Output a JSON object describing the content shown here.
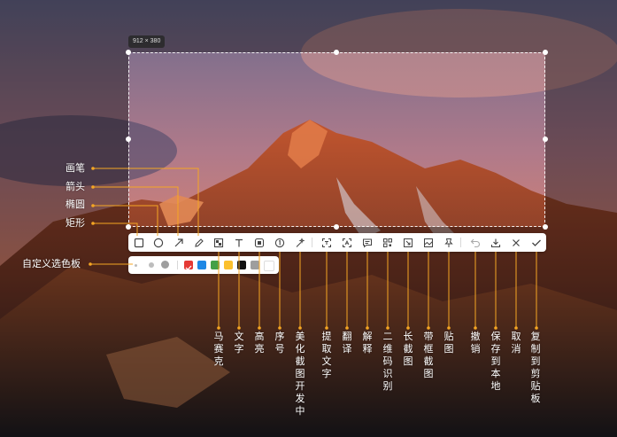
{
  "selection": {
    "size_label": "912 × 380"
  },
  "toolbar": {
    "tools": [
      {
        "id": "rect",
        "icon": "square-icon"
      },
      {
        "id": "ellipse",
        "icon": "circle-icon"
      },
      {
        "id": "arrow",
        "icon": "arrow-icon"
      },
      {
        "id": "pen",
        "icon": "pencil-icon"
      },
      {
        "id": "mosaic",
        "icon": "mosaic-icon"
      },
      {
        "id": "text",
        "icon": "text-icon"
      },
      {
        "id": "highlight",
        "icon": "highlight-icon"
      },
      {
        "id": "number",
        "icon": "number-icon"
      },
      {
        "id": "beautify",
        "icon": "magic-wand-icon"
      },
      {
        "id": "ocr",
        "icon": "ocr-icon"
      },
      {
        "id": "translate",
        "icon": "translate-icon"
      },
      {
        "id": "explain",
        "icon": "explain-icon"
      },
      {
        "id": "qrcode",
        "icon": "qrcode-icon"
      },
      {
        "id": "long-screenshot",
        "icon": "long-screenshot-icon"
      },
      {
        "id": "frame-screenshot",
        "icon": "frame-icon"
      },
      {
        "id": "pin",
        "icon": "pin-icon"
      },
      {
        "id": "undo",
        "icon": "undo-icon"
      },
      {
        "id": "save",
        "icon": "download-icon"
      },
      {
        "id": "cancel",
        "icon": "close-icon"
      },
      {
        "id": "copy",
        "icon": "check-icon"
      }
    ]
  },
  "palette": {
    "colors": [
      "#e53935",
      "#1e88e5",
      "#43a047",
      "#fbc02d",
      "#111111",
      "#9e9e9e",
      "#ffffff"
    ],
    "selected_index": 0
  },
  "left_labels": {
    "pen": "画笔",
    "arrow": "箭头",
    "ellipse": "椭圆",
    "rect": "矩形",
    "custom_palette": "自定义选色板"
  },
  "bottom_labels": {
    "mosaic": "马赛克",
    "text": "文字",
    "highlight": "高亮",
    "number": "序号",
    "beautify": "美化截图开发中",
    "ocr": "提取文字",
    "translate": "翻译",
    "explain": "解释",
    "qrcode": "二维码识别",
    "long_screenshot": "长截图",
    "frame_screenshot": "带框截图",
    "pin": "贴图",
    "undo": "撤销",
    "save": "保存到本地",
    "cancel": "取消",
    "copy": "复制到剪贴板"
  },
  "colors": {
    "callout": "#f5a623",
    "toolbar_bg": "#ffffff",
    "icon": "#444444"
  }
}
